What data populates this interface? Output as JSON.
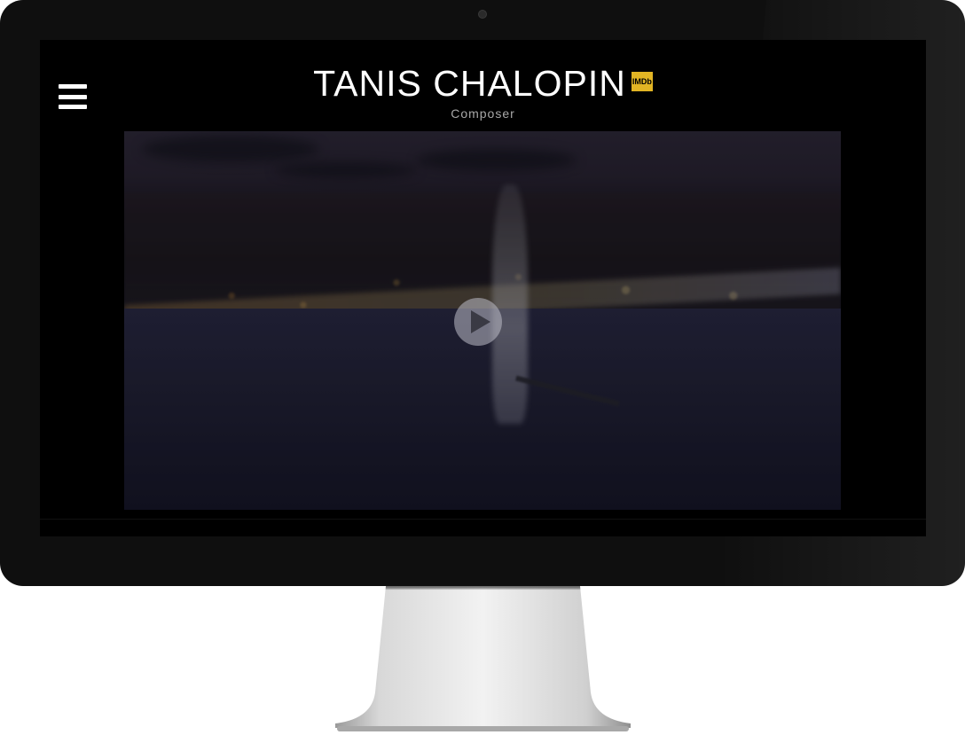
{
  "header": {
    "name": "TANIS CHALOPIN",
    "imdb_badge": "IMDb",
    "subtitle": "Composer"
  },
  "icons": {
    "menu": "hamburger-menu-icon",
    "play": "play-icon"
  },
  "colors": {
    "background": "#000000",
    "imdb": "#e2b524",
    "title": "#ffffff",
    "subtitle": "#a8a8a8"
  }
}
